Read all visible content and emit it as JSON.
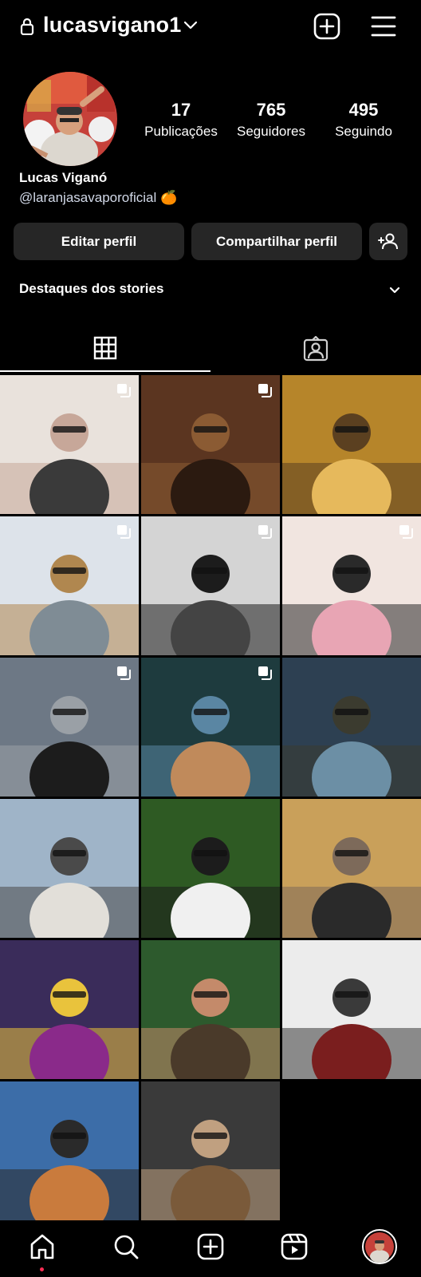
{
  "header": {
    "username": "lucasvigano1",
    "lock_icon": "lock-icon",
    "account_switch_icon": "chevron-down-icon",
    "create_icon": "plus-square-icon",
    "menu_icon": "hamburger-menu-icon"
  },
  "profile": {
    "stats": [
      {
        "value": "17",
        "label": "Publicações"
      },
      {
        "value": "765",
        "label": "Seguidores"
      },
      {
        "value": "495",
        "label": "Seguindo"
      }
    ],
    "full_name": "Lucas Viganó",
    "handle": "@laranjasavaporoficial 🍊"
  },
  "actions": {
    "edit": "Editar perfil",
    "share": "Compartilhar perfil",
    "discover_icon": "add-person-icon"
  },
  "highlights": {
    "title": "Destaques dos stories"
  },
  "tabs": [
    {
      "name": "posts-grid",
      "icon": "grid-icon",
      "active": true
    },
    {
      "name": "tagged",
      "icon": "tagged-person-icon",
      "active": false
    }
  ],
  "posts": [
    {
      "multi": true,
      "colors": [
        "#e9e2dc",
        "#3a3a3a",
        "#c7a799"
      ]
    },
    {
      "multi": true,
      "colors": [
        "#5b3520",
        "#2b1a10",
        "#8b5b33"
      ]
    },
    {
      "multi": false,
      "colors": [
        "#b6852a",
        "#e6b95c",
        "#5b4020"
      ]
    },
    {
      "multi": true,
      "colors": [
        "#dde3ea",
        "#7f8c95",
        "#b0874f"
      ]
    },
    {
      "multi": true,
      "colors": [
        "#d4d4d4",
        "#444444",
        "#1c1c1c"
      ]
    },
    {
      "multi": true,
      "colors": [
        "#f1e5e0",
        "#e8a5b4",
        "#2a2a2a"
      ]
    },
    {
      "multi": true,
      "colors": [
        "#6d7885",
        "#1c1c1c",
        "#9aa0a6"
      ]
    },
    {
      "multi": true,
      "colors": [
        "#1e3b3e",
        "#c08a5b",
        "#5a86a3"
      ]
    },
    {
      "multi": false,
      "colors": [
        "#2d4052",
        "#6c8fa5",
        "#3b3b2f"
      ]
    },
    {
      "multi": false,
      "colors": [
        "#9fb4c8",
        "#e2dfd9",
        "#4a4a4a"
      ]
    },
    {
      "multi": false,
      "colors": [
        "#2e5a23",
        "#f0f0f0",
        "#1c1c1c"
      ]
    },
    {
      "multi": false,
      "colors": [
        "#c9a05a",
        "#2a2a2a",
        "#7d6a5a"
      ]
    },
    {
      "multi": false,
      "colors": [
        "#3a2c5a",
        "#8a2a8a",
        "#e9c33c"
      ]
    },
    {
      "multi": false,
      "colors": [
        "#2d5a2d",
        "#4a3a2a",
        "#c48a6a"
      ]
    },
    {
      "multi": false,
      "colors": [
        "#ececec",
        "#7a1e1e",
        "#3a3a3a"
      ]
    },
    {
      "multi": false,
      "colors": [
        "#3c6da8",
        "#c97b3d",
        "#2a2a2a"
      ]
    },
    {
      "multi": false,
      "colors": [
        "#3a3a3a",
        "#7a5a3a",
        "#c0a080"
      ]
    }
  ],
  "bottom_nav": [
    {
      "name": "home",
      "icon": "home-icon",
      "active": true
    },
    {
      "name": "search",
      "icon": "search-icon"
    },
    {
      "name": "create",
      "icon": "plus-square-icon"
    },
    {
      "name": "reels",
      "icon": "reels-icon"
    },
    {
      "name": "profile",
      "icon": "avatar-icon"
    }
  ],
  "colors": {
    "background": "#000000",
    "button": "#262626",
    "text": "#ffffff",
    "handle": "#d2d9e8",
    "notification_dot": "#ff2d55"
  }
}
